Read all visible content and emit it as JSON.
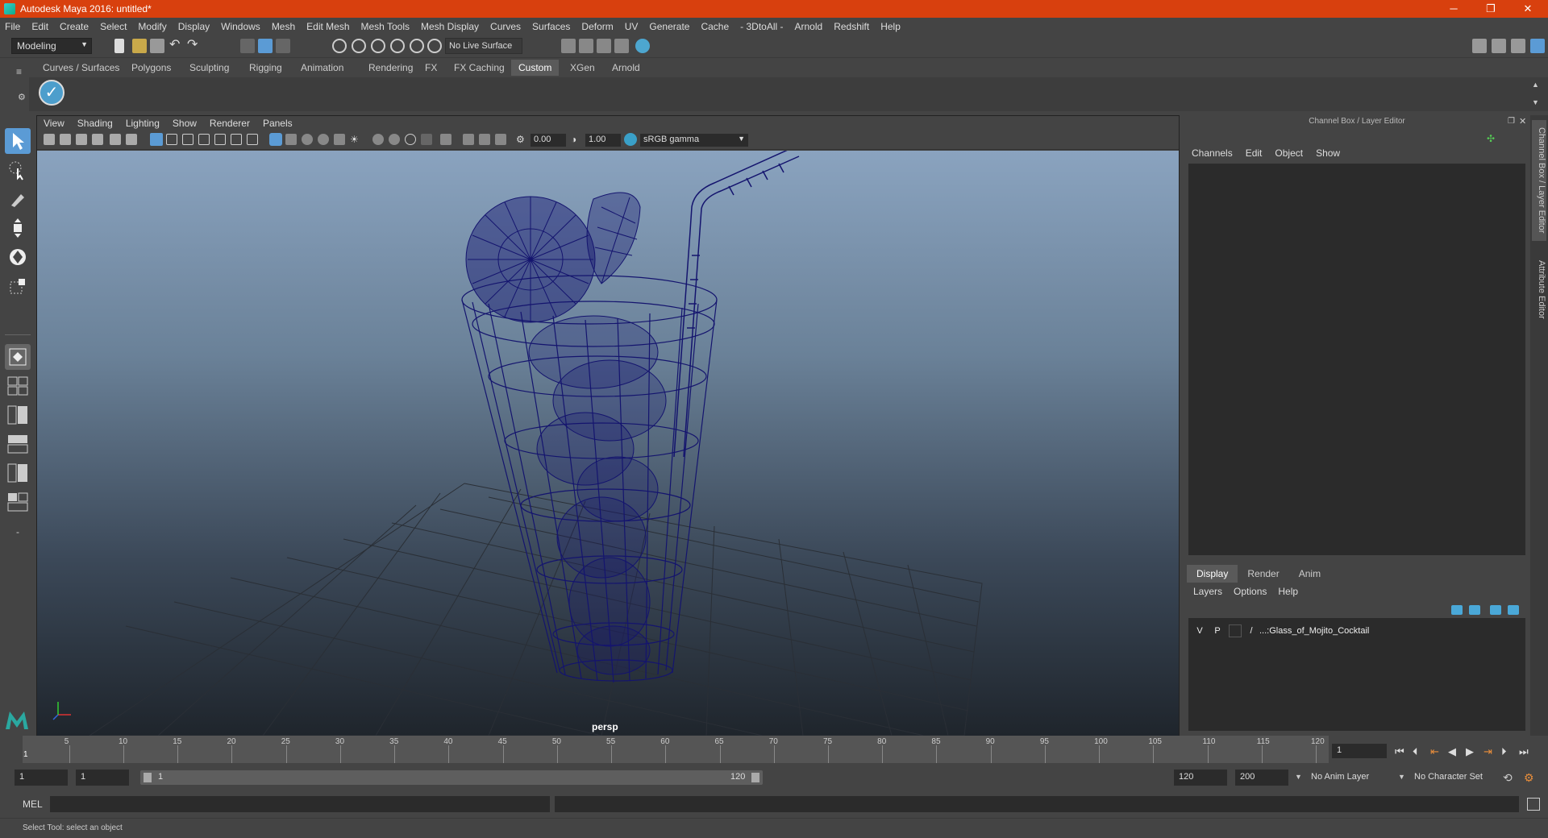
{
  "window": {
    "title": "Autodesk Maya 2016: untitled*"
  },
  "menubar": [
    "File",
    "Edit",
    "Create",
    "Select",
    "Modify",
    "Display",
    "Windows",
    "Mesh",
    "Edit Mesh",
    "Mesh Tools",
    "Mesh Display",
    "Curves",
    "Surfaces",
    "Deform",
    "UV",
    "Generate",
    "Cache",
    "- 3DtoAll -",
    "Arnold",
    "Redshift",
    "Help"
  ],
  "statusline": {
    "mode": "Modeling",
    "live_surface": "No Live Surface"
  },
  "shelf": {
    "tabs": [
      "Curves / Surfaces",
      "Polygons",
      "Sculpting",
      "Rigging",
      "Animation",
      "Rendering",
      "FX",
      "FX Caching",
      "Custom",
      "XGen",
      "Arnold"
    ],
    "active_tab": "Custom"
  },
  "viewport": {
    "menu": [
      "View",
      "Shading",
      "Lighting",
      "Show",
      "Renderer",
      "Panels"
    ],
    "exposure": "0.00",
    "gamma": "1.00",
    "color_space": "sRGB gamma",
    "camera_label": "persp"
  },
  "channel_box": {
    "title": "Channel Box / Layer Editor",
    "menu": [
      "Channels",
      "Edit",
      "Object",
      "Show"
    ]
  },
  "layer_editor": {
    "tabs": [
      "Display",
      "Render",
      "Anim"
    ],
    "active_tab": "Display",
    "menu": [
      "Layers",
      "Options",
      "Help"
    ],
    "layers": [
      {
        "v": "V",
        "p": "P",
        "name": "...:Glass_of_Mojito_Cocktail"
      }
    ]
  },
  "side_tabs": [
    "Channel Box / Layer Editor",
    "Attribute Editor"
  ],
  "timeline": {
    "ticks": [
      "5",
      "10",
      "15",
      "20",
      "25",
      "30",
      "35",
      "40",
      "45",
      "50",
      "55",
      "60",
      "65",
      "70",
      "75",
      "80",
      "85",
      "90",
      "95",
      "100",
      "105",
      "110",
      "115",
      "120"
    ],
    "start_marker": "1",
    "current_frame": "1"
  },
  "range": {
    "start": "1",
    "playback_start": "1",
    "slider_start": "1",
    "slider_end": "120",
    "playback_end": "120",
    "end": "200",
    "anim_layer": "No Anim Layer",
    "character_set": "No Character Set"
  },
  "command_line": {
    "label": "MEL"
  },
  "help_line": {
    "text": "Select Tool: select an object"
  },
  "colors": {
    "titlebar": "#d8400e",
    "active_tool": "#5b9bd5",
    "wireframe": "#14146e"
  }
}
